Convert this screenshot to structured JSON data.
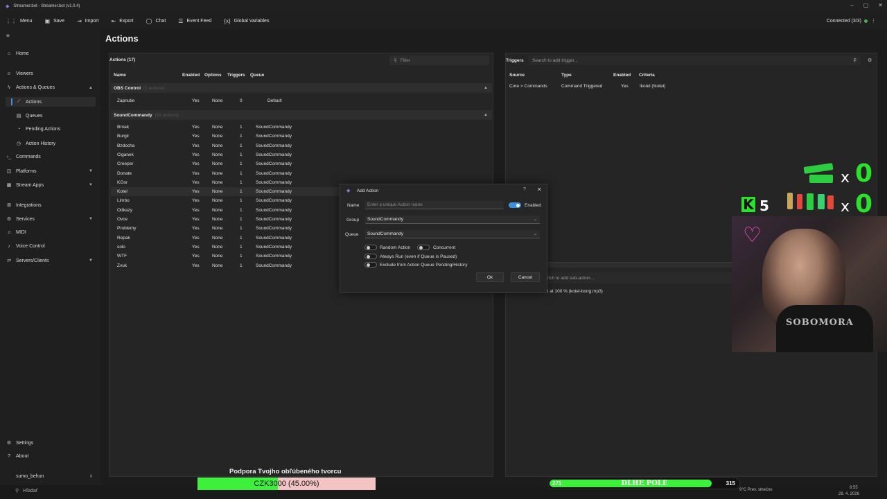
{
  "window": {
    "title": "Streamer.bot - Streamer.bot (v1.0.4)"
  },
  "menubar": [
    {
      "icon": "grid-icon",
      "label": "Menu"
    },
    {
      "icon": "save-icon",
      "label": "Save"
    },
    {
      "icon": "import-icon",
      "label": "Import"
    },
    {
      "icon": "export-icon",
      "label": "Export"
    },
    {
      "icon": "chat-icon",
      "label": "Chat"
    },
    {
      "icon": "event-feed-icon",
      "label": "Event Feed"
    },
    {
      "icon": "variables-icon",
      "label": "Global Variables"
    }
  ],
  "connection": {
    "label": "Connected (3/3)",
    "color": "#4caf50"
  },
  "sidebar": {
    "items": [
      {
        "label": "Home",
        "icon": "home-icon"
      },
      {
        "label": "Viewers",
        "icon": "users-icon"
      },
      {
        "label": "Actions & Queues",
        "icon": "bolt-icon"
      },
      {
        "label": "Actions",
        "icon": "action-icon"
      },
      {
        "label": "Queues",
        "icon": "queue-icon"
      },
      {
        "label": "Pending Actions",
        "icon": "pending-icon"
      },
      {
        "label": "Action History",
        "icon": "history-icon"
      },
      {
        "label": "Commands",
        "icon": "terminal-icon"
      },
      {
        "label": "Platforms",
        "icon": "platforms-icon"
      },
      {
        "label": "Stream Apps",
        "icon": "apps-icon"
      },
      {
        "label": "Integrations",
        "icon": "integrations-icon"
      },
      {
        "label": "Services",
        "icon": "services-icon"
      },
      {
        "label": "MIDI",
        "icon": "midi-icon"
      },
      {
        "label": "Voice Control",
        "icon": "mic-icon"
      },
      {
        "label": "Servers/Clients",
        "icon": "server-icon"
      },
      {
        "label": "Settings",
        "icon": "gear-icon"
      },
      {
        "label": "About",
        "icon": "help-icon"
      },
      {
        "label": "sumo_behun",
        "icon": "user-icon"
      }
    ]
  },
  "page_title": "Actions",
  "actions_panel": {
    "title": "Actions (17)",
    "filter_placeholder": "Filter",
    "columns": [
      "Name",
      "Enabled",
      "Options",
      "Triggers",
      "Queue"
    ],
    "groups": [
      {
        "name": "OBS Control",
        "count": "(1 actions)"
      },
      {
        "name": "SoundCommandy",
        "count": "(16 actions)"
      }
    ],
    "obs_rows": [
      {
        "name": "Zapnutie",
        "enabled": "Yes",
        "options": "None",
        "triggers": "0",
        "queue": "Default"
      }
    ],
    "rows": [
      {
        "name": "Brnak",
        "enabled": "Yes",
        "options": "None",
        "triggers": "1",
        "queue": "SoundCommandy"
      },
      {
        "name": "Burgir",
        "enabled": "Yes",
        "options": "None",
        "triggers": "1",
        "queue": "SoundCommandy"
      },
      {
        "name": "Bzdocha",
        "enabled": "Yes",
        "options": "None",
        "triggers": "1",
        "queue": "SoundCommandy"
      },
      {
        "name": "Ciganek",
        "enabled": "Yes",
        "options": "None",
        "triggers": "1",
        "queue": "SoundCommandy"
      },
      {
        "name": "Creeper",
        "enabled": "Yes",
        "options": "None",
        "triggers": "1",
        "queue": "SoundCommandy"
      },
      {
        "name": "Donate",
        "enabled": "Yes",
        "options": "None",
        "triggers": "1",
        "queue": "SoundCommandy"
      },
      {
        "name": "KGor",
        "enabled": "Yes",
        "options": "None",
        "triggers": "1",
        "queue": "SoundCommandy"
      },
      {
        "name": "Kotel",
        "enabled": "Yes",
        "options": "None",
        "triggers": "1",
        "queue": "SoundCommandy"
      },
      {
        "name": "Limbo",
        "enabled": "Yes",
        "options": "None",
        "triggers": "1",
        "queue": "SoundCommandy"
      },
      {
        "name": "Odkazy",
        "enabled": "Yes",
        "options": "None",
        "triggers": "1",
        "queue": "SoundCommandy"
      },
      {
        "name": "Ovce",
        "enabled": "Yes",
        "options": "None",
        "triggers": "1",
        "queue": "SoundCommandy"
      },
      {
        "name": "Problemy",
        "enabled": "Yes",
        "options": "None",
        "triggers": "1",
        "queue": "SoundCommandy"
      },
      {
        "name": "Repak",
        "enabled": "Yes",
        "options": "None",
        "triggers": "1",
        "queue": "SoundCommandy"
      },
      {
        "name": "solo",
        "enabled": "Yes",
        "options": "None",
        "triggers": "1",
        "queue": "SoundCommandy"
      },
      {
        "name": "WTF",
        "enabled": "Yes",
        "options": "None",
        "triggers": "1",
        "queue": "SoundCommandy"
      },
      {
        "name": "Zvuk",
        "enabled": "Yes",
        "options": "None",
        "triggers": "1",
        "queue": "SoundCommandy"
      }
    ],
    "selected_row": "Kotel"
  },
  "triggers_panel": {
    "title": "Triggers",
    "search_placeholder": "Search to add trigger...",
    "columns": [
      "Source",
      "Type",
      "Enabled",
      "Criteria"
    ],
    "rows": [
      {
        "source": "Core > Commands",
        "type": "Command Triggered",
        "enabled": "Yes",
        "criteria": "!kotel (!kotel)"
      }
    ]
  },
  "subactions": {
    "search_placeholder": "ltch to add sub-action...",
    "row": "l at 100 % (kotel-bong.mp3)"
  },
  "dialog": {
    "title": "Add Action",
    "name_label": "Name",
    "name_placeholder": "Enter a unique Action name",
    "enabled_label": "Enabled",
    "enabled": true,
    "group_label": "Group",
    "group_value": "SoundCommandy",
    "queue_label": "Queue",
    "queue_value": "SoundCommandy",
    "random_label": "Random Action",
    "concurrent_label": "Concurrent",
    "always_run_label": "Always Run (even if Queue is Paused)",
    "exclude_label": "Exclude from Action Queue Pending/History",
    "ok_label": "Ok",
    "cancel_label": "Cancel"
  },
  "overlay": {
    "counter_top": "0",
    "counter_bottom": "0",
    "x_sign": "x",
    "kick_count": "5",
    "kick_letter": "K",
    "shirt_text": "SOBOMORA",
    "donation_title": "Podpora Tvojho obľúbeného tvorcu",
    "donation_text": "CZK3000 (45.00%)",
    "donation_progress": 0.45,
    "goal_left": "271",
    "goal_center": "DLHE POLE",
    "goal_right": "315",
    "goal_progress": 0.86,
    "accent_green": "#3cf03c"
  },
  "taskbar": {
    "search_placeholder": "Hľadať",
    "weather": "9°C Prev. slnečno",
    "time": "8:55",
    "date": "28. 4. 2026"
  }
}
